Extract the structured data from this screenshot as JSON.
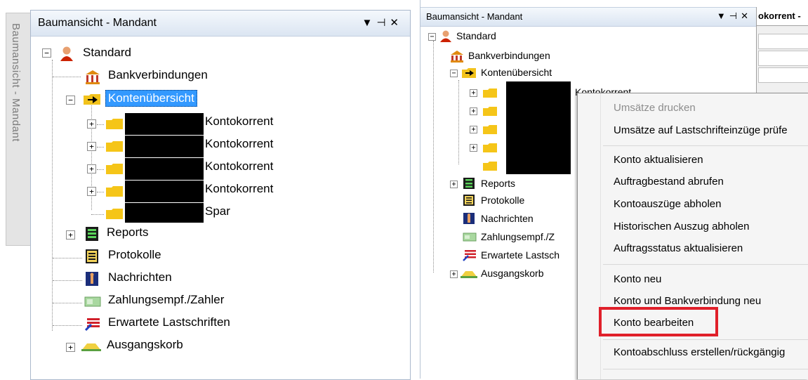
{
  "left": {
    "side_tab_label": "Baumansicht - Mandant",
    "panel_title": "Baumansicht - Mandant",
    "panel_buttons": "▾ ⊣ ✕",
    "tree": {
      "root": "Standard",
      "bank": "Bankverbindungen",
      "konten": "Kontenübersicht",
      "accounts": [
        "Kontokorrent",
        "Kontokorrent",
        "Kontokorrent",
        "Kontokorrent",
        "Spar"
      ],
      "reports": "Reports",
      "protokolle": "Protokolle",
      "nachrichten": "Nachrichten",
      "zahlung": "Zahlungsempf./Zahler",
      "lastschriften": "Erwartete Lastschriften",
      "ausgang": "Ausgangskorb"
    }
  },
  "right": {
    "panel_title": "Baumansicht - Mandant",
    "panel_buttons": "▾ ⊣ ✕",
    "header_partial": "okorrent -",
    "tree": {
      "root": "Standard",
      "bank": "Bankverbindungen",
      "konten": "Kontenübersicht",
      "account_first": "Kontokorrent",
      "reports": "Reports",
      "protokolle": "Protokolle",
      "nachrichten": "Nachrichten",
      "zahlung": "Zahlungsempf./Z",
      "lastschriften": "Erwartete Lastsch",
      "ausgang": "Ausgangskorb"
    },
    "context_menu": {
      "umsaetze_drucken": "Umsätze drucken",
      "umsaetze_pruefen": "Umsätze auf Lastschrifteinzüge prüfe",
      "konto_aktualisieren": "Konto aktualisieren",
      "auftragbestand": "Auftragbestand abrufen",
      "kontoauszuege": "Kontoauszüge abholen",
      "historisch": "Historischen Auszug abholen",
      "auftragsstatus": "Auftragsstatus aktualisieren",
      "konto_neu": "Konto neu",
      "konto_bank_neu": "Konto und Bankverbindung neu",
      "konto_bearbeiten": "Konto bearbeiten",
      "kontoabschluss": "Kontoabschluss erstellen/rückgängig"
    }
  },
  "colors": {
    "selection": "#3399ff",
    "highlight_box": "#e0202a",
    "folder": "#f5c518",
    "panel_title_gradient": "#dbe5f2"
  }
}
